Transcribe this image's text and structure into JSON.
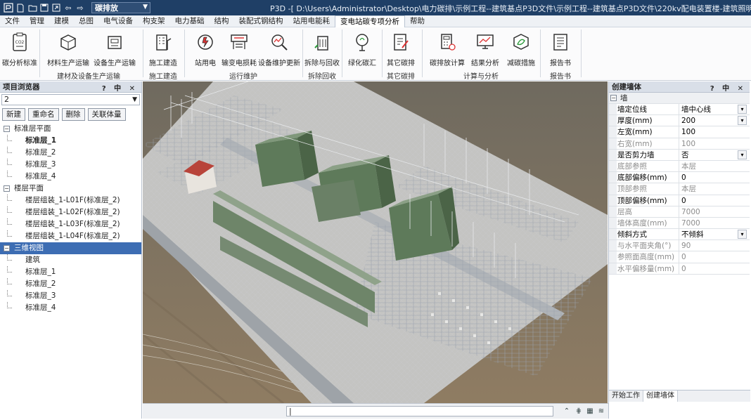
{
  "titlebar": {
    "quick_access": [
      "new-file-icon",
      "open-folder-icon",
      "save-icon",
      "export-icon",
      "undo-icon",
      "redo-icon"
    ],
    "view_select": "碳排放",
    "title": "P3D -[ D:\\Users\\Administrator\\Desktop\\电力碳排\\示例工程--建筑基点P3D文件\\示例工程--建筑基点P3D文件\\220kv配电装置楼-建筑照明要逐.p3d ] - [全楼] [视"
  },
  "menu_tabs": [
    "文件",
    "管理",
    "建模",
    "总图",
    "电气设备",
    "构支架",
    "电力基础",
    "结构",
    "装配式钢结构",
    "站用电能耗",
    "变电站碳专项分析",
    "帮助"
  ],
  "active_menu_tab": "变电站碳专项分析",
  "ribbon": {
    "buttons": [
      "碳分析标准",
      "材料生产运输",
      "设备生产运输",
      "施工建造",
      "站用电",
      "输变电损耗",
      "设备维护更新",
      "拆除与回收",
      "绿化碳汇",
      "其它碳排",
      "碳排放计算",
      "结果分析",
      "减碳措施",
      "报告书"
    ],
    "groups": [
      "建材及设备生产运输",
      "施工建造",
      "运行维护",
      "拆除回收",
      "其它碳排",
      "计算与分析",
      "报告书"
    ]
  },
  "left_panel": {
    "title": "项目浏览器",
    "controls": "? 中 ✕",
    "combo_value": "2",
    "buttons": [
      "新建",
      "重命名",
      "删除",
      "关联体量"
    ],
    "tree": [
      {
        "label": "标准层平面",
        "level": 0,
        "box": "⊟"
      },
      {
        "label": "标准层_1",
        "level": 1,
        "bold": true
      },
      {
        "label": "标准层_2",
        "level": 1
      },
      {
        "label": "标准层_3",
        "level": 1
      },
      {
        "label": "标准层_4",
        "level": 1
      },
      {
        "label": "楼层平面",
        "level": 0,
        "box": "⊟"
      },
      {
        "label": "楼层组装_1-L01F(标准层_2)",
        "level": 1
      },
      {
        "label": "楼层组装_1-L02F(标准层_2)",
        "level": 1
      },
      {
        "label": "楼层组装_1-L03F(标准层_2)",
        "level": 1
      },
      {
        "label": "楼层组装_1-L04F(标准层_2)",
        "level": 1
      },
      {
        "label": "三维视图",
        "level": 0,
        "box": "⊟",
        "selected": true
      },
      {
        "label": "建筑",
        "level": 1
      },
      {
        "label": "标准层_1",
        "level": 1
      },
      {
        "label": "标准层_2",
        "level": 1
      },
      {
        "label": "标准层_3",
        "level": 1
      },
      {
        "label": "标准层_4",
        "level": 1
      }
    ]
  },
  "right_panel": {
    "title": "创建墙体",
    "controls": "? 中 ✕",
    "category": "墙",
    "properties": [
      {
        "label": "墙定位线",
        "value": "墙中心线",
        "dropdown": true,
        "enabled": true
      },
      {
        "label": "厚度(mm)",
        "value": "200",
        "dropdown": true,
        "enabled": true
      },
      {
        "label": "左宽(mm)",
        "value": "100",
        "enabled": true
      },
      {
        "label": "右宽(mm)",
        "value": "100",
        "enabled": false
      },
      {
        "label": "是否剪力墙",
        "value": "否",
        "dropdown": true,
        "enabled": true
      },
      {
        "label": "底部参照",
        "value": "本层",
        "enabled": false
      },
      {
        "label": "底部偏移(mm)",
        "value": "0",
        "enabled": true
      },
      {
        "label": "顶部参照",
        "value": "本层",
        "enabled": false
      },
      {
        "label": "顶部偏移(mm)",
        "value": "0",
        "enabled": true
      },
      {
        "label": "层高",
        "value": "7000",
        "enabled": false
      },
      {
        "label": "墙体高度(mm)",
        "value": "7000",
        "enabled": false
      },
      {
        "label": "倾斜方式",
        "value": "不倾斜",
        "dropdown": true,
        "enabled": true
      },
      {
        "label": "与水平面夹角(°)",
        "value": "90",
        "enabled": false
      },
      {
        "label": "参照面高度(mm)",
        "value": "0",
        "enabled": false
      },
      {
        "label": "水平偏移量(mm)",
        "value": "0",
        "enabled": false
      }
    ],
    "bottom_tabs": [
      "开始工作",
      "创建墙体"
    ],
    "active_bottom_tab": "创建墙体"
  },
  "status_bar": {
    "cursor": "|"
  },
  "watermark": "大数跨境",
  "colors": {
    "titlebar": "#1f3f66",
    "selection": "#3d6db3",
    "ground": "#8a7a63",
    "building_green": "#5e7a5a"
  }
}
